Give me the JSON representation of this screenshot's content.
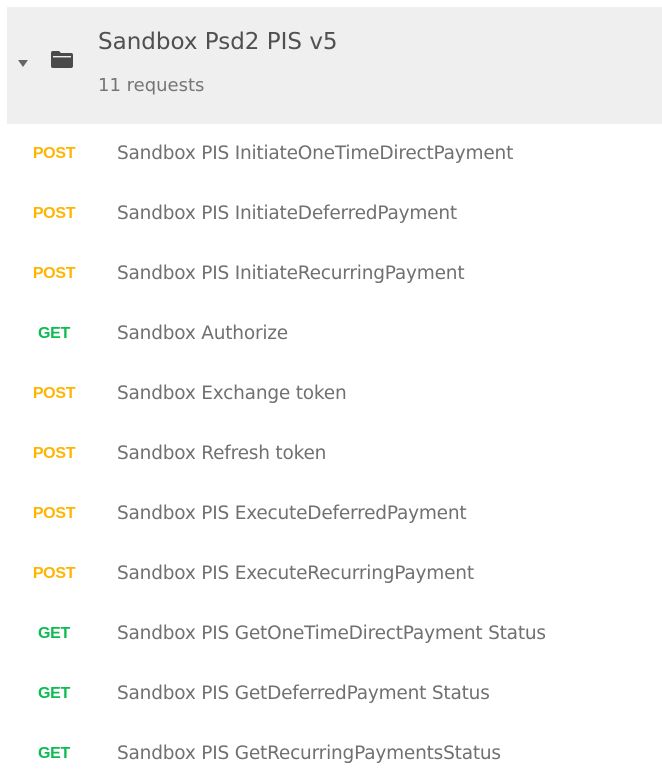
{
  "collection": {
    "title": "Sandbox Psd2 PIS v5",
    "request_count": "11 requests",
    "icons": {
      "caret": "caret-down-icon",
      "folder": "folder-icon"
    }
  },
  "colors": {
    "post": "#ffb400",
    "get": "#0cbb52",
    "header_bg": "#efefef",
    "text": "#707070"
  },
  "requests": [
    {
      "method": "POST",
      "name": "Sandbox PIS InitiateOneTimeDirectPayment"
    },
    {
      "method": "POST",
      "name": "Sandbox PIS InitiateDeferredPayment"
    },
    {
      "method": "POST",
      "name": "Sandbox PIS InitiateRecurringPayment"
    },
    {
      "method": "GET",
      "name": "Sandbox Authorize"
    },
    {
      "method": "POST",
      "name": "Sandbox Exchange token"
    },
    {
      "method": "POST",
      "name": "Sandbox Refresh token"
    },
    {
      "method": "POST",
      "name": "Sandbox PIS ExecuteDeferredPayment"
    },
    {
      "method": "POST",
      "name": "Sandbox PIS ExecuteRecurringPayment"
    },
    {
      "method": "GET",
      "name": "Sandbox PIS GetOneTimeDirectPayment Status"
    },
    {
      "method": "GET",
      "name": "Sandbox PIS GetDeferredPayment Status"
    },
    {
      "method": "GET",
      "name": "Sandbox PIS GetRecurringPaymentsStatus"
    }
  ]
}
